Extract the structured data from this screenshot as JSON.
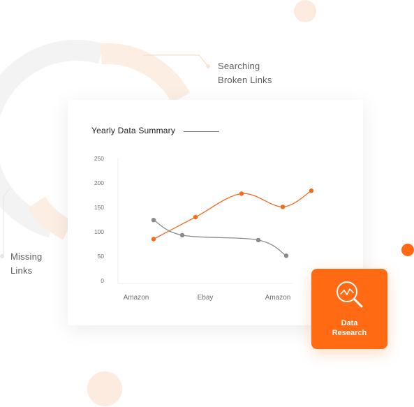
{
  "callouts": {
    "top": {
      "line1": "Searching",
      "line2": "Broken Links"
    },
    "left": {
      "line1": "Missing",
      "line2": "Links"
    }
  },
  "card": {
    "title": "Yearly Data Summary"
  },
  "action_tile": {
    "line1": "Data",
    "line2": "Research",
    "icon": "magnifier-chart-icon"
  },
  "colors": {
    "accent": "#ff6a13",
    "series_orange": "#f26a1b",
    "series_gray": "#8a8a8a",
    "donut_gray": "#f3f3f3",
    "donut_peach": "#fdebe0"
  },
  "chart_data": {
    "type": "line",
    "title": "Yearly Data Summary",
    "x_tick_labels": [
      "Amazon",
      "Ebay",
      "Amazon"
    ],
    "y_ticks": [
      0,
      50,
      100,
      150,
      200,
      250
    ],
    "ylim": [
      0,
      250
    ],
    "grid": false,
    "series": [
      {
        "color": "#f26a1b",
        "values": [
          85,
          130,
          178,
          151,
          184
        ]
      },
      {
        "color": "#8a8a8a",
        "values": [
          124,
          93,
          83,
          51
        ]
      }
    ]
  }
}
